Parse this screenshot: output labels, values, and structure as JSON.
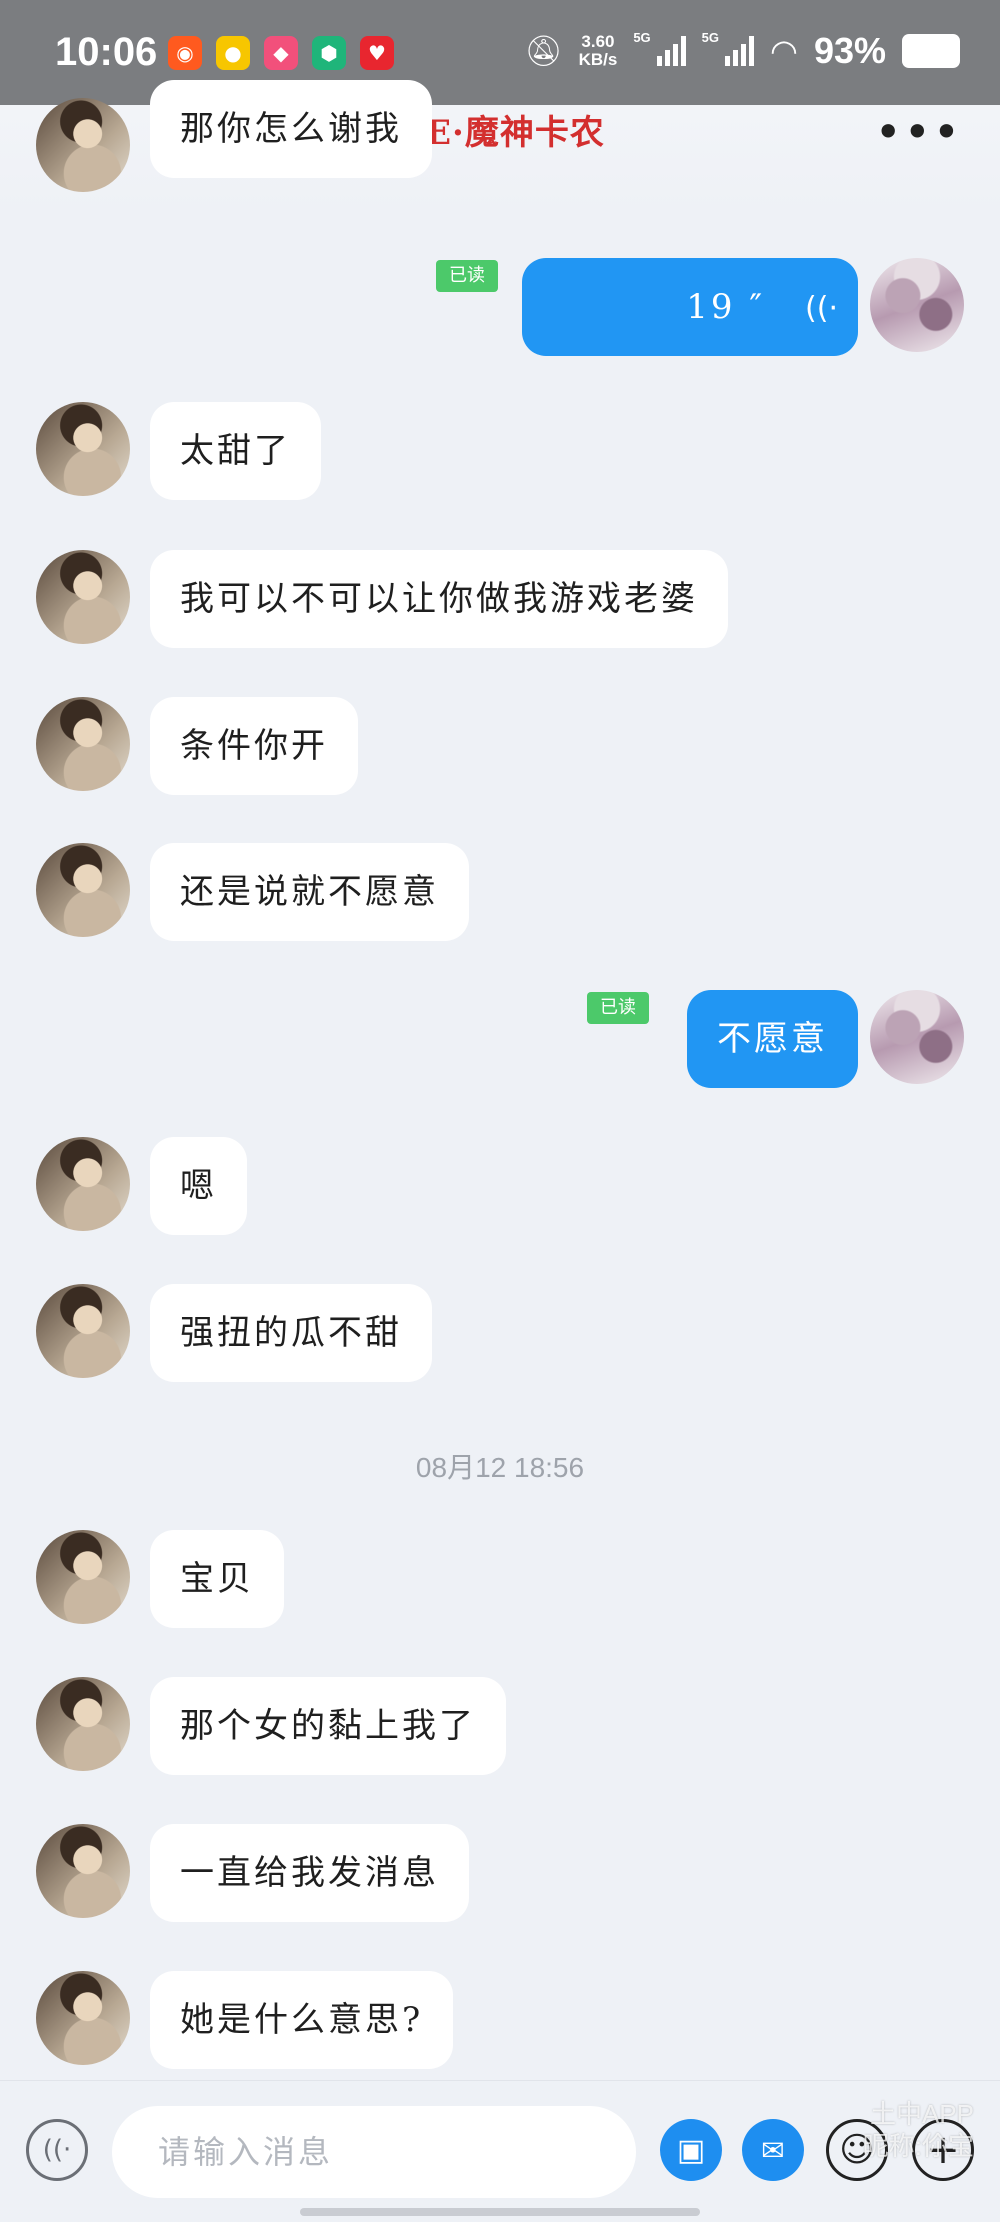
{
  "status_bar": {
    "time": "10:06",
    "net_speed_value": "3.60",
    "net_speed_unit": "KB/s",
    "network_1": "5G",
    "network_2": "5G",
    "battery": "93%",
    "app_icons": [
      "taobao-icon",
      "meituan-icon",
      "app-icon",
      "shield-app-icon",
      "heart-app-icon"
    ],
    "colors": {
      "bg": "#7b7d80"
    }
  },
  "header": {
    "title": "GE·魔神卡农",
    "back_icon": "chevron-left-icon",
    "more_icon": "more-dots-icon",
    "title_color": "#d32f2f"
  },
  "messages": [
    {
      "from": "them",
      "text": "那你怎么谢我",
      "partial": true
    },
    {
      "from": "me",
      "type": "voice",
      "text": "19 ″",
      "read_label": "已读"
    },
    {
      "from": "them",
      "text": "太甜了"
    },
    {
      "from": "them",
      "text": "我可以不可以让你做我游戏老婆"
    },
    {
      "from": "them",
      "text": "条件你开"
    },
    {
      "from": "them",
      "text": "还是说就不愿意"
    },
    {
      "from": "me",
      "text": "不愿意",
      "read_label": "已读"
    },
    {
      "from": "them",
      "text": "嗯"
    },
    {
      "from": "them",
      "text": "强扭的瓜不甜"
    },
    {
      "type": "timestamp",
      "text": "08月12 18:56"
    },
    {
      "from": "them",
      "text": "宝贝"
    },
    {
      "from": "them",
      "text": "那个女的黏上我了"
    },
    {
      "from": "them",
      "text": "一直给我发消息"
    },
    {
      "from": "them",
      "text": "她是什么意思?"
    }
  ],
  "input_bar": {
    "placeholder": "请输入消息",
    "icons": [
      "voice-icon",
      "gift-icon",
      "red-packet-icon",
      "emoji-icon",
      "plus-icon"
    ],
    "accent": "#1e8ef0"
  },
  "watermark": {
    "line1": "土中APP",
    "line2": "昵称:伱宝"
  }
}
